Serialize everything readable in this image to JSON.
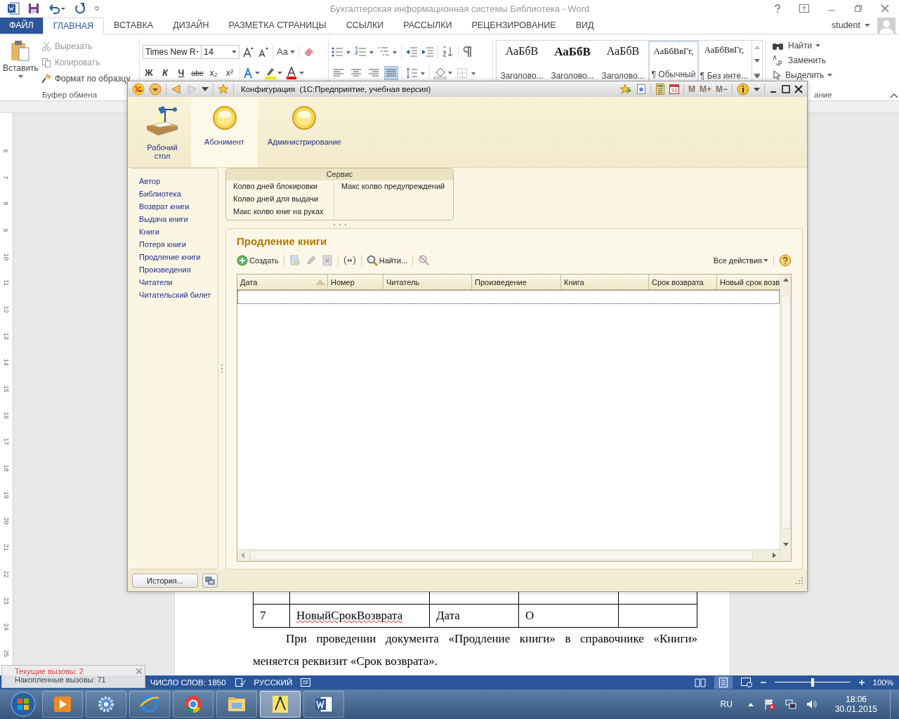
{
  "word": {
    "title": "Бухгалтерская информационная системы Библиотека - Word",
    "user": "student",
    "tabs": [
      {
        "label": "ФАЙЛ",
        "kind": "file",
        "selected": false
      },
      {
        "label": "ГЛАВНАЯ",
        "kind": "tab",
        "selected": true
      },
      {
        "label": "ВСТАВКА",
        "kind": "tab",
        "selected": false
      },
      {
        "label": "ДИЗАЙН",
        "kind": "tab",
        "selected": false
      },
      {
        "label": "РАЗМЕТКА СТРАНИЦЫ",
        "kind": "tab",
        "selected": false
      },
      {
        "label": "ССЫЛКИ",
        "kind": "tab",
        "selected": false
      },
      {
        "label": "РАССЫЛКИ",
        "kind": "tab",
        "selected": false
      },
      {
        "label": "РЕЦЕНЗИРОВАНИЕ",
        "kind": "tab",
        "selected": false
      },
      {
        "label": "ВИД",
        "kind": "tab",
        "selected": false
      }
    ],
    "clipboard": {
      "paste": "Вставить",
      "cut": "Вырезать",
      "copy": "Копировать",
      "format_painter": "Формат по образцу",
      "group_label": "Буфер обмена"
    },
    "font": {
      "name": "Times New R",
      "size": "14",
      "case_button": "Aa"
    },
    "format_buttons": [
      {
        "label": "Ж",
        "kind": "bold"
      },
      {
        "label": "К",
        "kind": "italic"
      },
      {
        "label": "Ч",
        "kind": "underline"
      },
      {
        "label": "abc",
        "kind": "strike"
      },
      {
        "label": "x₂",
        "kind": "plain"
      },
      {
        "label": "x²",
        "kind": "plain"
      }
    ],
    "align_buttons": [
      {
        "selected": false
      },
      {
        "selected": false
      },
      {
        "selected": false
      },
      {
        "selected": true
      }
    ],
    "styles": [
      {
        "preview": "АаБбВ",
        "label": "Заголово...",
        "kind": "heading",
        "selected": false
      },
      {
        "preview": "АаБбВ",
        "label": "Заголово...",
        "kind": "title",
        "selected": false
      },
      {
        "preview": "АаБбВ",
        "label": "Заголово...",
        "kind": "heading",
        "selected": false
      },
      {
        "preview": "АаБбВвГг,",
        "label": "¶ Обычный",
        "kind": "body",
        "selected": true
      },
      {
        "preview": "АаБбВвГг,",
        "label": "¶ Без инте...",
        "kind": "body",
        "selected": false
      }
    ],
    "editing": {
      "find": "Найти",
      "replace": "Заменить",
      "select": "Выделить",
      "group_label": "ание"
    },
    "ruler_marks": [
      "6",
      "7",
      "8",
      "9",
      "10",
      "11",
      "12",
      "13",
      "14",
      "15",
      "16",
      "17",
      "18",
      "19",
      "20",
      "21",
      "22",
      "23",
      "24",
      "25"
    ],
    "document": {
      "table_rows": [
        {
          "cells": [
            "7",
            "НовыйСрокВозврата",
            "Дата",
            "О"
          ]
        }
      ],
      "paragraph": "При проведении документа «Продление книги» в справочнике «Книги» меняется реквизит «Срок возврата»."
    },
    "status_bar": {
      "word_count": "ЧИСЛО СЛОВ: 1850",
      "language": "РУССКИЙ",
      "zoom": "100%",
      "zoom_slider": {
        "level": 0.5
      }
    },
    "notification": {
      "lines": [
        "Текущие вызовы: 2",
        "Накопленные вызовы: 71"
      ]
    },
    "taskbar": {
      "apps": [
        {
          "kind": "player",
          "selected": false
        },
        {
          "kind": "gear",
          "selected": false
        },
        {
          "kind": "browser",
          "selected": false
        },
        {
          "kind": "chrome",
          "selected": false
        },
        {
          "kind": "folder",
          "selected": false
        },
        {
          "kind": "compass",
          "selected": true
        },
        {
          "kind": "word",
          "selected": false
        }
      ],
      "language": "RU",
      "time": "18:06",
      "date": "30.01.2015"
    }
  },
  "onec": {
    "title": "Конфигурация  (1С:Предприятие, учебная версия)",
    "memory_buttons": [
      "M",
      "M+",
      "M−"
    ],
    "calendar_day": "31",
    "sections": [
      {
        "label": "Рабочий стол",
        "kind": "desk",
        "selected": false
      },
      {
        "label": "Абонимент",
        "kind": "circle",
        "selected": true
      },
      {
        "label": "Администрирование",
        "kind": "circle",
        "selected": false
      }
    ],
    "nav_items": [
      "Автор",
      "Библиотека",
      "Возврат книги",
      "Выдача книги",
      "Книги",
      "Потеря книги",
      "Продление книги",
      "Произведения",
      "Читатели",
      "Читательский билет"
    ],
    "service": {
      "title": "Сервис",
      "column_1": [
        "Колво дней блокировки",
        "Колво дней для выдачи",
        "Макс колво книг на руках"
      ],
      "column_2": [
        "Макс колво предупреждений"
      ]
    },
    "form": {
      "title": "Продление книги",
      "toolbar": {
        "create": "Создать",
        "find": "Найти...",
        "all_actions": "Все действия"
      },
      "columns": [
        "Дата",
        "Номер",
        "Читатель",
        "Произведение",
        "Книга",
        "Срок возврата",
        "Новый срок возв"
      ]
    },
    "history_button": "История..."
  }
}
